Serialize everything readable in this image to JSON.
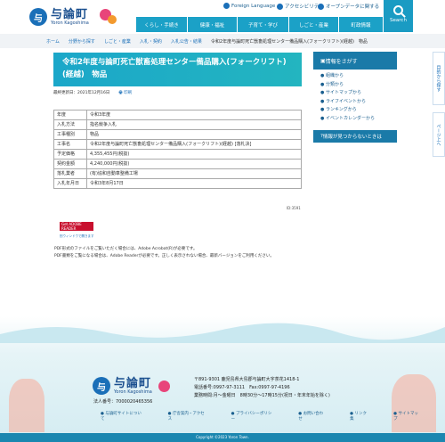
{
  "header": {
    "logo_text": "与論町",
    "logo_sub": "Yoron Kagoshima",
    "foreign_language": "Foreign Language",
    "accessibility": "アクセシビリティ",
    "open_data": "オープンデータに関する",
    "search_label": "Search"
  },
  "gnav": [
    "くらし・手続き",
    "健康・福祉",
    "子育て・学び",
    "しごと・産業",
    "町政情報"
  ],
  "breadcrumb": [
    "ホーム",
    "分野から探す",
    "しごと・産業",
    "入札・契約",
    "入札公告・結果",
    "令和2年度与論町死亡獣畜処理センター備品購入(フォークリフト)(経越)　物品"
  ],
  "page": {
    "title": "令和2年度与論町死亡獣畜処理センター備品購入(フォークリフト)(経越)　物品",
    "updated": "最終更新日：2021年12月16日",
    "print": "印刷",
    "ref": "ID:3591"
  },
  "table_rows": [
    {
      "k": "年度",
      "v": "令和3年度"
    },
    {
      "k": "入札方法",
      "v": "指名競争入札"
    },
    {
      "k": "工事種別",
      "v": "物品"
    },
    {
      "k": "工事名",
      "v": "令和2年度与論町死亡獣畜処理センター備品購入(フォークリフト)(経越) [落札決]"
    },
    {
      "k": "予定価格",
      "v": "4,355,455円(税抜)"
    },
    {
      "k": "契約金額",
      "v": "4,240,000円(税抜)"
    },
    {
      "k": "落札業者",
      "v": "(有)協和自動車整備工場"
    },
    {
      "k": "入札年月日",
      "v": "令和3年8月17日"
    }
  ],
  "pdf": {
    "badge": "Get ADOBE READER",
    "link": "別ウィンドウで開きます",
    "note1": "PDF形式のファイルをご覧いただく場合には、Adobe Acrobat(R)が必要です。",
    "note2": "PDF書類をご覧になる場合は、Adobe Readerが必要です。正しく表示されない場合、最新バージョンをご利用ください。"
  },
  "side": {
    "header": "情報をさがす",
    "links": [
      "組織から",
      "分類から",
      "サイトマップから",
      "ライフイベントから",
      "ランキングから",
      "イベントカレンダーから"
    ],
    "notfound": "情報が見つからないときは"
  },
  "tabs": {
    "purpose": "目的から探す",
    "top": "ページ上へ"
  },
  "footer": {
    "address": "〒891-9301 鹿児島県大島郡与論町大字茶花1418-1",
    "tel": "電話番号:0997-97-3111　Fax:0997-97-4196",
    "hours": "業務時間:月～金曜日　8時30分～17時15分(祝日・年末年始を除く)",
    "code": "法人番号：7000020465356",
    "links": [
      "与論町サイトについて",
      "庁舎案内・アクセス",
      "プライバシーポリシー",
      "お問い合わせ",
      "リンク集",
      "サイトマップ"
    ],
    "copyright": "Copyright ©2023 Yoron Town."
  }
}
